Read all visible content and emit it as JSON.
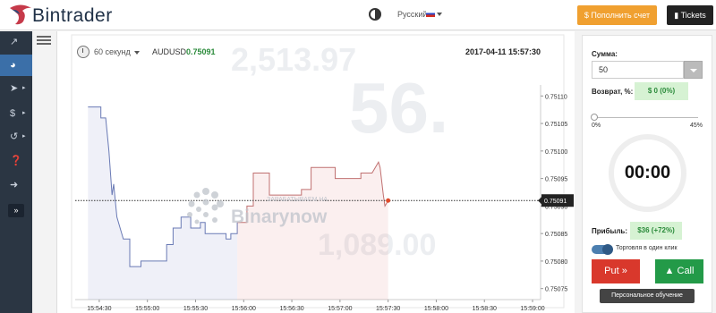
{
  "app": {
    "brand": "Bintrader"
  },
  "header": {
    "language": "Русский",
    "deposit_label": "$ Пополнить счет",
    "tickets_label": "Tickets"
  },
  "sidebar": {
    "items": [
      {
        "icon": "chart-icon"
      },
      {
        "icon": "clock-icon",
        "active": true
      },
      {
        "icon": "send-icon"
      },
      {
        "icon": "dollar-icon"
      },
      {
        "icon": "history-icon"
      },
      {
        "icon": "help-icon"
      },
      {
        "icon": "logout-icon"
      }
    ],
    "expand_label": "»"
  },
  "chart_header": {
    "period": "60 секунд",
    "symbol": "AUDUSD",
    "price": "0.75091",
    "datetime": "2017-04-11 15:57:30"
  },
  "watermark": {
    "brand": "Binarynow",
    "tagline": "ЗАРАБАТЫВАЕМ НА"
  },
  "chart_data": {
    "type": "line",
    "x_labels": [
      "15:54:30",
      "15:55:00",
      "15:55:30",
      "15:56:00",
      "15:56:30",
      "15:57:00",
      "15:57:30",
      "15:58:00",
      "15:58:30",
      "15:59:00"
    ],
    "y_ticks": [
      0.7511,
      0.75105,
      0.751,
      0.75095,
      0.7509,
      0.75085,
      0.7508,
      0.75075
    ],
    "ylim": [
      0.75073,
      0.75112
    ],
    "current_price": 0.75091,
    "current_label": "0.75091",
    "series": [
      {
        "color": "#6a7ab5",
        "points": [
          [
            "15:54:23",
            0.75108
          ],
          [
            "15:54:31",
            0.75108
          ],
          [
            "15:54:31",
            0.75106
          ],
          [
            "15:54:34",
            0.75106
          ],
          [
            "15:54:36",
            0.751
          ],
          [
            "15:54:38",
            0.75092
          ],
          [
            "15:54:39",
            0.75094
          ],
          [
            "15:54:41",
            0.75088
          ],
          [
            "15:54:43",
            0.75086
          ],
          [
            "15:54:45",
            0.75084
          ],
          [
            "15:54:49",
            0.75084
          ],
          [
            "15:54:49",
            0.75079
          ],
          [
            "15:54:56",
            0.75079
          ],
          [
            "15:54:56",
            0.7508
          ],
          [
            "15:55:12",
            0.7508
          ],
          [
            "15:55:12",
            0.75083
          ],
          [
            "15:55:16",
            0.75083
          ],
          [
            "15:55:16",
            0.75086
          ],
          [
            "15:55:21",
            0.75086
          ],
          [
            "15:55:21",
            0.75088
          ],
          [
            "15:55:27",
            0.75088
          ],
          [
            "15:55:27",
            0.75086
          ],
          [
            "15:55:33",
            0.75086
          ],
          [
            "15:55:33",
            0.75087
          ],
          [
            "15:55:36",
            0.75087
          ],
          [
            "15:55:36",
            0.75085
          ],
          [
            "15:55:49",
            0.75085
          ],
          [
            "15:55:49",
            0.75084
          ],
          [
            "15:55:52",
            0.75084
          ],
          [
            "15:55:52",
            0.75085
          ],
          [
            "15:55:56",
            0.75085
          ],
          [
            "15:55:56",
            0.75087
          ]
        ]
      },
      {
        "color": "#c07070",
        "points": [
          [
            "15:55:56",
            0.75087
          ],
          [
            "15:56:02",
            0.75087
          ],
          [
            "15:56:02",
            0.7509
          ],
          [
            "15:56:06",
            0.7509
          ],
          [
            "15:56:06",
            0.75096
          ],
          [
            "15:56:16",
            0.75096
          ],
          [
            "15:56:16",
            0.75092
          ],
          [
            "15:56:36",
            0.75092
          ],
          [
            "15:56:36",
            0.75093
          ],
          [
            "15:56:42",
            0.75093
          ],
          [
            "15:56:42",
            0.75097
          ],
          [
            "15:56:57",
            0.75097
          ],
          [
            "15:56:57",
            0.75095
          ],
          [
            "15:57:13",
            0.75095
          ],
          [
            "15:57:13",
            0.75096
          ],
          [
            "15:57:20",
            0.75096
          ],
          [
            "15:57:24",
            0.75098
          ],
          [
            "15:57:25",
            0.75097
          ],
          [
            "15:57:27",
            0.75092
          ],
          [
            "15:57:28",
            0.7509
          ],
          [
            "15:57:30",
            0.75091
          ]
        ]
      }
    ]
  },
  "trade_panel": {
    "amount_label": "Сумма:",
    "amount_value": "50",
    "return_label": "Возврат, %:",
    "return_value": "$ 0 (0%)",
    "slider_min": "0%",
    "slider_max": "45%",
    "slider_fraction": 0.0,
    "countdown": "00:00",
    "profit_label": "Прибыль:",
    "profit_value": "$36 (+72%)",
    "one_click_label": "Торговля в один клик",
    "put_label": "Put »",
    "call_label": "Call",
    "training_label": "Персональное обучение",
    "colors": {
      "put": "#d9382c",
      "call": "#239a48",
      "deposit": "#f0a030"
    }
  }
}
